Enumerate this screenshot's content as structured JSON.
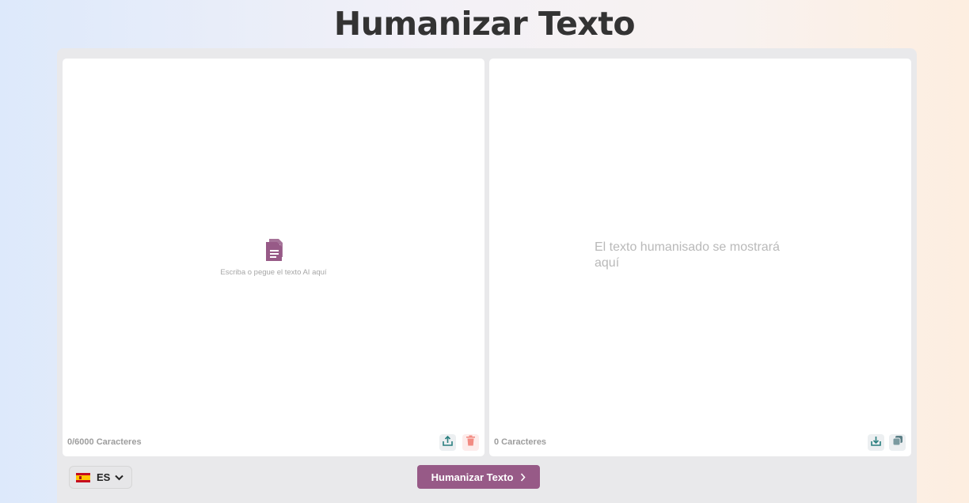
{
  "page": {
    "title": "Humanizar Texto"
  },
  "input_panel": {
    "hint": "Escriba o pegue el texto AI aquí",
    "char_count": "0/6000 Caracteres",
    "icons": {
      "upload": "upload-icon",
      "delete": "trash-icon",
      "document": "document-icon"
    }
  },
  "output_panel": {
    "placeholder": "El texto humanisado se mostrará aquí",
    "char_count": "0 Caracteres",
    "icons": {
      "download": "download-icon",
      "copy": "copy-icon"
    }
  },
  "language_selector": {
    "code": "ES",
    "flag": "spain-flag-icon"
  },
  "humanize_button": {
    "label": "Humanizar Texto"
  },
  "colors": {
    "accent": "#975a87",
    "teal": "#2a7f7f",
    "delete": "#f28b82",
    "muted_text": "#9d9d9d"
  }
}
